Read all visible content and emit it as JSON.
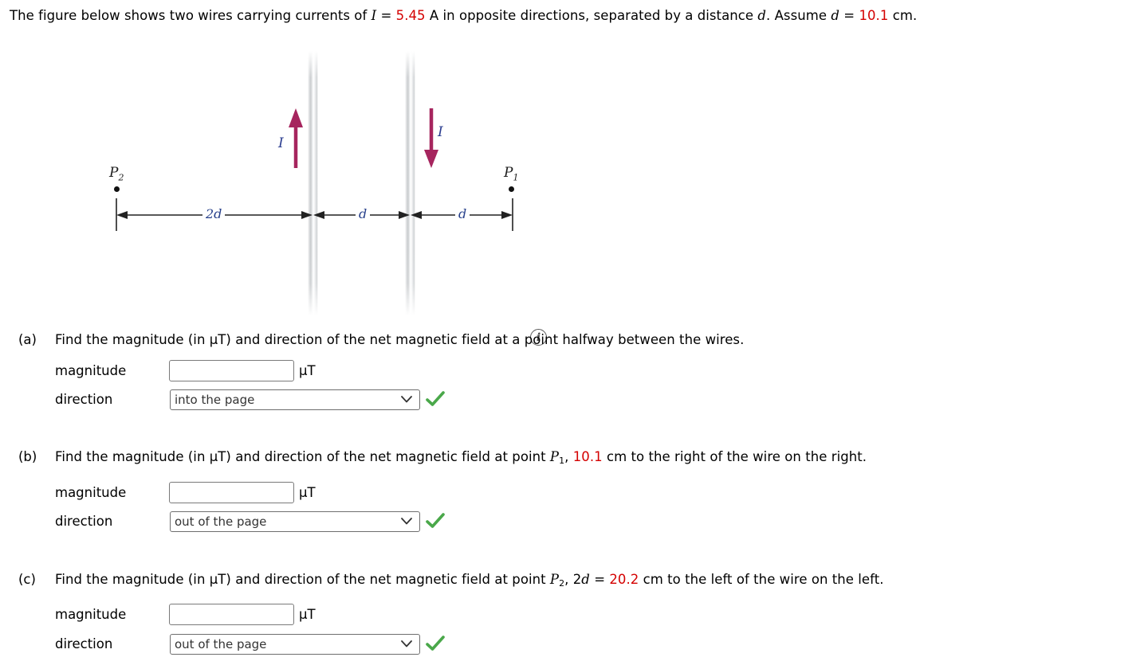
{
  "prompt": {
    "seg1": "The figure below shows two wires carrying currents of ",
    "var_I": "I",
    "eq1": " = ",
    "current_value": "5.45",
    "seg2": " A in opposite directions, separated by a distance ",
    "var_d1": "d",
    "seg3": ". Assume ",
    "var_d2": "d",
    "eq2": " = ",
    "distance_value": "10.1",
    "seg4": " cm."
  },
  "figure": {
    "current_label_left": "I",
    "current_label_right": "I",
    "point_left_label": "P",
    "point_left_sub": "2",
    "point_right_label": "P",
    "point_right_sub": "1",
    "dim_2d": "2d",
    "dim_d_middle": "d",
    "dim_d_right": "d",
    "info_icon": "i",
    "arrow_color": "#a6255e",
    "label_color": "#27408b",
    "wire_color": "#cfd2d4"
  },
  "parts": [
    {
      "letter": "(a)",
      "text_pre": "Find the magnitude (in µT) and direction of the net magnetic field at a point halfway between the wires.",
      "magnitude_label": "magnitude",
      "magnitude_value": "",
      "magnitude_placeholder": "",
      "unit": "µT",
      "direction_label": "direction",
      "direction_value": "into the page",
      "direction_options": [
        "into the page",
        "out of the page"
      ],
      "correct": true
    },
    {
      "letter": "(b)",
      "text_pre": "Find the magnitude (in µT) and direction of the net magnetic field at point ",
      "point_var": "P",
      "point_sub": "1",
      "text_mid": ", ",
      "value": "10.1",
      "text_post": " cm to the right of the wire on the right.",
      "magnitude_label": "magnitude",
      "magnitude_value": "",
      "magnitude_placeholder": "",
      "unit": "µT",
      "direction_label": "direction",
      "direction_value": "out of the page",
      "direction_options": [
        "into the page",
        "out of the page"
      ],
      "correct": true
    },
    {
      "letter": "(c)",
      "text_pre": "Find the magnitude (in µT) and direction of the net magnetic field at point ",
      "point_var": "P",
      "point_sub": "2",
      "text_mid": ", 2",
      "mid_var": "d",
      "text_eq": " = ",
      "value": "20.2",
      "text_post": " cm to the left of the wire on the left.",
      "magnitude_label": "magnitude",
      "magnitude_value": "",
      "magnitude_placeholder": "",
      "unit": "µT",
      "direction_label": "direction",
      "direction_value": "out of the page",
      "direction_options": [
        "into the page",
        "out of the page"
      ],
      "correct": true
    }
  ],
  "colors": {
    "highlight_red": "#d40000",
    "check_green": "#4aa84a",
    "arrow_magenta": "#a6255e"
  }
}
